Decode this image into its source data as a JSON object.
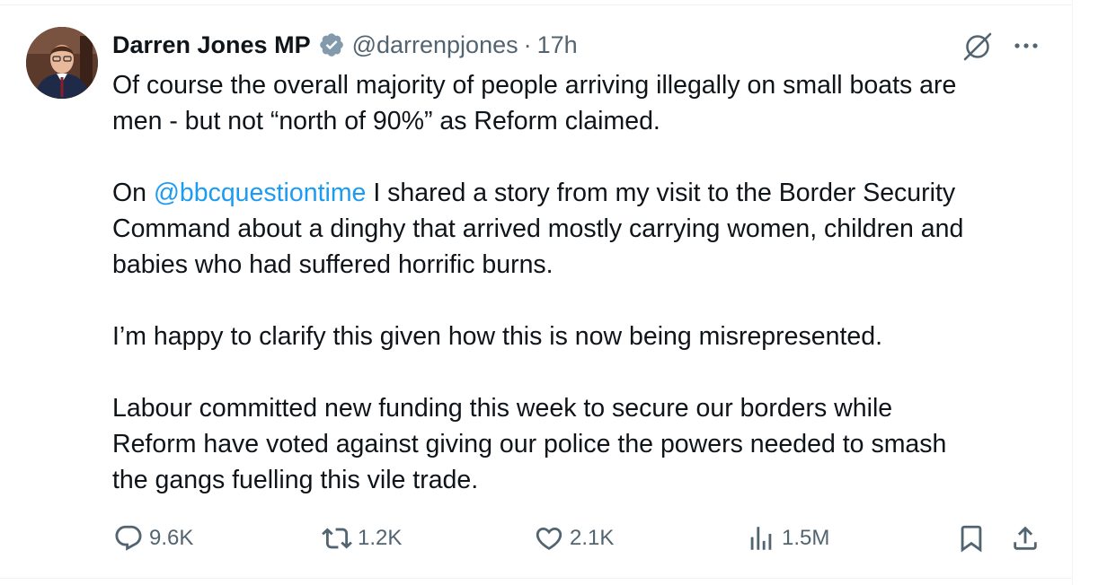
{
  "author": {
    "name": "Darren Jones MP",
    "handle": "@darrenpjones",
    "separator": "·",
    "time": "17h"
  },
  "tweet": {
    "line1_pre": "Of course the overall majority of people arriving illegally on small boats are",
    "line2": "men - but not “north of 90%” as Reform claimed.",
    "para2_prefix": "On ",
    "para2_mention": "@bbcquestiontime",
    "para2_rest_line1": " I shared a story from my visit to the Border Security",
    "para2_line2": "Command about a dinghy that arrived mostly carrying women, children and",
    "para2_line3": "babies who had suffered horrific burns.",
    "para3": "I’m happy to clarify this given how this is now being misrepresented.",
    "para4_line1": "Labour committed new funding this week to secure our borders while",
    "para4_line2": "Reform have voted against giving our police the powers needed to smash",
    "para4_line3": "the gangs fuelling this vile trade."
  },
  "actions": {
    "replies": "9.6K",
    "reposts": "1.2K",
    "likes": "2.1K",
    "views": "1.5M"
  },
  "icons": {
    "verified": "verified-badge-icon",
    "grok": "grok-icon",
    "more": "more-icon",
    "reply": "reply-icon",
    "repost": "repost-icon",
    "like": "heart-icon",
    "views": "views-icon",
    "bookmark": "bookmark-icon",
    "share": "share-icon"
  },
  "colors": {
    "text": "#0f1419",
    "secondary": "#536471",
    "mention": "#1d9bf0",
    "verified_badge": "#829aab"
  }
}
